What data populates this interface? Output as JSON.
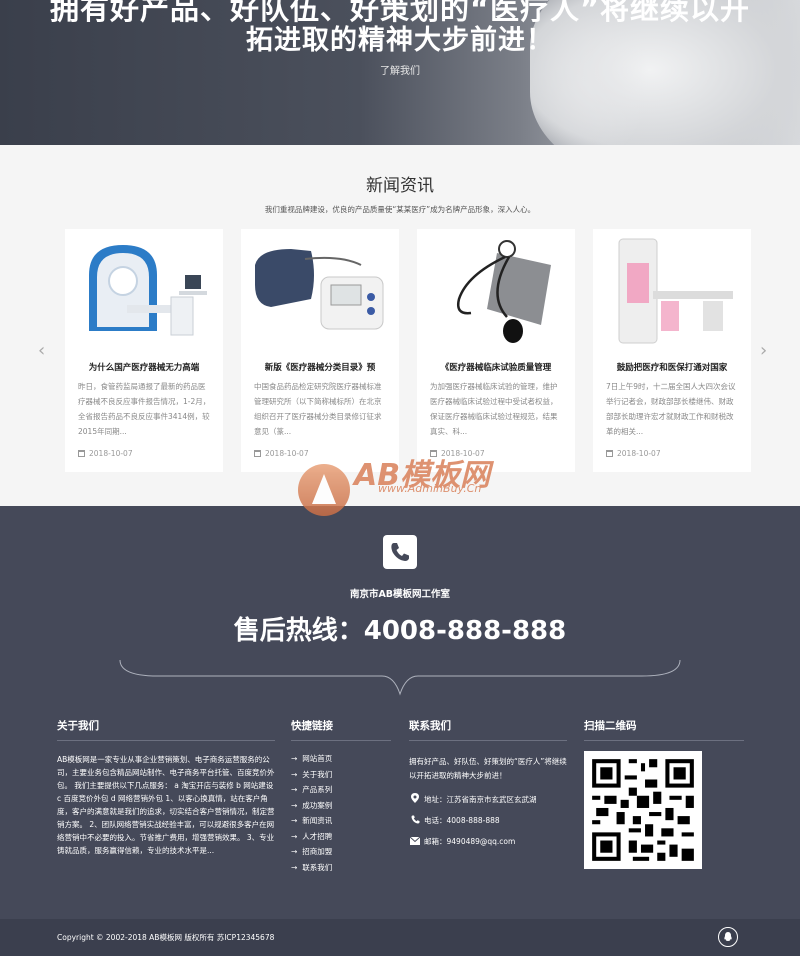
{
  "hero": {
    "line1": "拥有好产品、好队伍、好策划的“医疗人”将继续以开",
    "line2": "拓进取的精神大步前进！",
    "more_label": "了解我们"
  },
  "news": {
    "title": "新闻资讯",
    "subtitle": "我们重视品牌建设，优良的产品质量使“某某医疗”成为名牌产品形象，深入人心。",
    "prev_icon": "chevron-left-icon",
    "next_icon": "chevron-right-icon",
    "cards": [
      {
        "title": "为什么国产医疗器械无力高端",
        "excerpt": "昨日，食管药监局通报了最新的药品医疗器械不良反应事件报告情况，1-2月，全省报告药品不良反应事件3414例，较2015年同期...",
        "date": "2018-10-07",
        "image": "mri-scanner"
      },
      {
        "title": "新版《医疗器械分类目录》预",
        "excerpt": "中国食品药品检定研究院医疗器械标准管理研究所（以下简称械标所）在北京组织召开了医疗器械分类目录修订征求意见（篆...",
        "date": "2018-10-07",
        "image": "blood-pressure-monitor"
      },
      {
        "title": "《医疗器械临床试验质量管理",
        "excerpt": "为加强医疗器械临床试验的管理，维护医疗器械临床试验过程中受试者权益，保证医疗器械临床试验过程规范，结果真实、科...",
        "date": "2018-10-07",
        "image": "sphygmomanometer"
      },
      {
        "title": "鼓励把医疗和医保打通对国家",
        "excerpt": "7日上午9时，十二届全国人大四次会议举行记者会，财政部部长楼继伟、财政部部长助理许宏才就财政工作和财税改革的相关...",
        "date": "2018-10-07",
        "image": "mammography-unit"
      }
    ]
  },
  "watermark": {
    "brand": "AB模板网",
    "url": "www.AdminBuy.Cn"
  },
  "contact": {
    "icon": "phone-icon",
    "studio": "南京市AB模板网工作室",
    "hotline": "售后热线：4008-888-888"
  },
  "footer": {
    "about": {
      "heading": "关于我们",
      "text": "AB模板网是一家专业从事企业营销策划、电子商务运营服务的公司，主要业务包含精品网站制作、电子商务平台托管、百度竞价外包。 我们主要提供以下几点服务： a 淘宝开店与装修 b 网站建设 c 百度竞价外包 d 网络营销外包 1、以客心换真情，站在客户角度，客户的满意就是我们的追求，切实结合客户营销情况，制定营销方案。 2、团队网络营销实战经验丰富，可以规避很多客户在网络营销中不必要的投入。节省推广费用，增强营销效果。 3、专业铸就品质，服务赢得信赖，专业的技术水平是..."
    },
    "links": {
      "heading": "快捷链接",
      "arrow": "→",
      "items": [
        "网站首页",
        "关于我们",
        "产品系列",
        "成功案例",
        "新闻资讯",
        "人才招聘",
        "招商加盟",
        "联系我们"
      ]
    },
    "contact": {
      "heading": "联系我们",
      "intro": "拥有好产品、好队伍、好策划的“医疗人”将继续以开拓进取的精神大步前进！",
      "address": "地址：江苏省南京市玄武区玄武湖",
      "phone": "电话：4008-888-888",
      "email": "邮箱：9490489@qq.com"
    },
    "qr": {
      "heading": "扫描二维码"
    }
  },
  "bottom": {
    "copyright": "Copyright © 2002-2018 AB模板网 版权所有 苏ICP12345678",
    "qq_icon": "qq-icon"
  }
}
